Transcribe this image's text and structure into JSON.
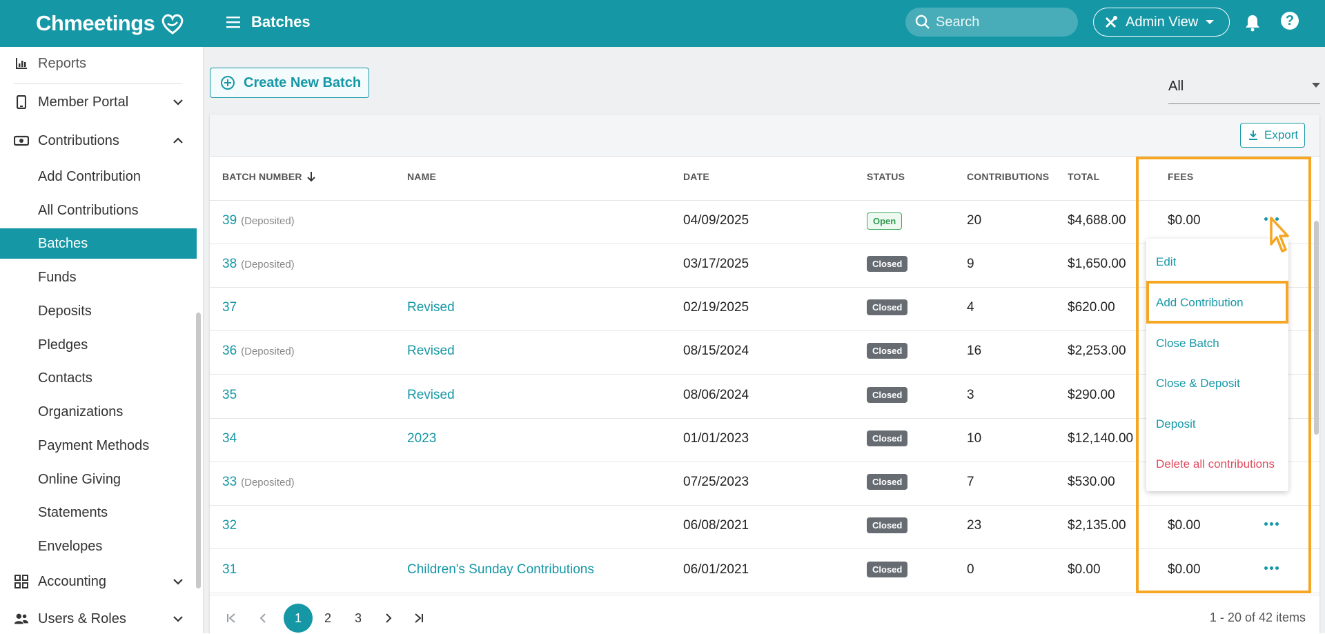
{
  "header": {
    "app_name": "Chmeetings",
    "page_title": "Batches",
    "search_placeholder": "Search",
    "admin_view_label": "Admin View",
    "help_label": "?"
  },
  "sidebar": {
    "items": [
      {
        "label": "Reports",
        "icon": "chart-icon"
      },
      {
        "label": "Member Portal",
        "icon": "phone-icon"
      },
      {
        "label": "Contributions",
        "icon": "money-icon"
      },
      {
        "label": "Add Contribution"
      },
      {
        "label": "All Contributions"
      },
      {
        "label": "Batches"
      },
      {
        "label": "Funds"
      },
      {
        "label": "Deposits"
      },
      {
        "label": "Pledges"
      },
      {
        "label": "Contacts"
      },
      {
        "label": "Organizations"
      },
      {
        "label": "Payment Methods"
      },
      {
        "label": "Online Giving"
      },
      {
        "label": "Statements"
      },
      {
        "label": "Envelopes"
      },
      {
        "label": "Accounting",
        "icon": "grid-icon"
      },
      {
        "label": "Users & Roles",
        "icon": "users-icon"
      }
    ]
  },
  "toolbar": {
    "create_label": "Create New Batch",
    "filter_value": "All",
    "export_label": "Export"
  },
  "table": {
    "headers": [
      "BATCH NUMBER",
      "NAME",
      "DATE",
      "STATUS",
      "CONTRIBUTIONS",
      "TOTAL",
      "FEES"
    ],
    "rows": [
      {
        "number": "39",
        "deposited": "(Deposited)",
        "name": "",
        "date": "04/09/2025",
        "status": "Open",
        "contributions": "20",
        "total": "$4,688.00",
        "fees": "$0.00"
      },
      {
        "number": "38",
        "deposited": "(Deposited)",
        "name": "",
        "date": "03/17/2025",
        "status": "Closed",
        "contributions": "9",
        "total": "$1,650.00",
        "fees": ""
      },
      {
        "number": "37",
        "deposited": "",
        "name": "Revised",
        "date": "02/19/2025",
        "status": "Closed",
        "contributions": "4",
        "total": "$620.00",
        "fees": ""
      },
      {
        "number": "36",
        "deposited": "(Deposited)",
        "name": "Revised",
        "date": "08/15/2024",
        "status": "Closed",
        "contributions": "16",
        "total": "$2,253.00",
        "fees": ""
      },
      {
        "number": "35",
        "deposited": "",
        "name": "Revised",
        "date": "08/06/2024",
        "status": "Closed",
        "contributions": "3",
        "total": "$290.00",
        "fees": ""
      },
      {
        "number": "34",
        "deposited": "",
        "name": "2023",
        "date": "01/01/2023",
        "status": "Closed",
        "contributions": "10",
        "total": "$12,140.00",
        "fees": ""
      },
      {
        "number": "33",
        "deposited": "(Deposited)",
        "name": "",
        "date": "07/25/2023",
        "status": "Closed",
        "contributions": "7",
        "total": "$530.00",
        "fees": ""
      },
      {
        "number": "32",
        "deposited": "",
        "name": "",
        "date": "06/08/2021",
        "status": "Closed",
        "contributions": "23",
        "total": "$2,135.00",
        "fees": "$0.00"
      },
      {
        "number": "31",
        "deposited": "",
        "name": "Children's Sunday Contributions",
        "date": "06/01/2021",
        "status": "Closed",
        "contributions": "0",
        "total": "$0.00",
        "fees": "$0.00"
      }
    ]
  },
  "row_menu": {
    "items": [
      "Edit",
      "Add Contribution",
      "Close Batch",
      "Close & Deposit",
      "Deposit",
      "Delete all contributions"
    ]
  },
  "pagination": {
    "pages": [
      "1",
      "2",
      "3"
    ],
    "current": "1",
    "info": "1 - 20 of 42 items"
  },
  "colors": {
    "brand": "#1597a6",
    "highlight": "#f5a623",
    "danger": "#e04a5f"
  }
}
